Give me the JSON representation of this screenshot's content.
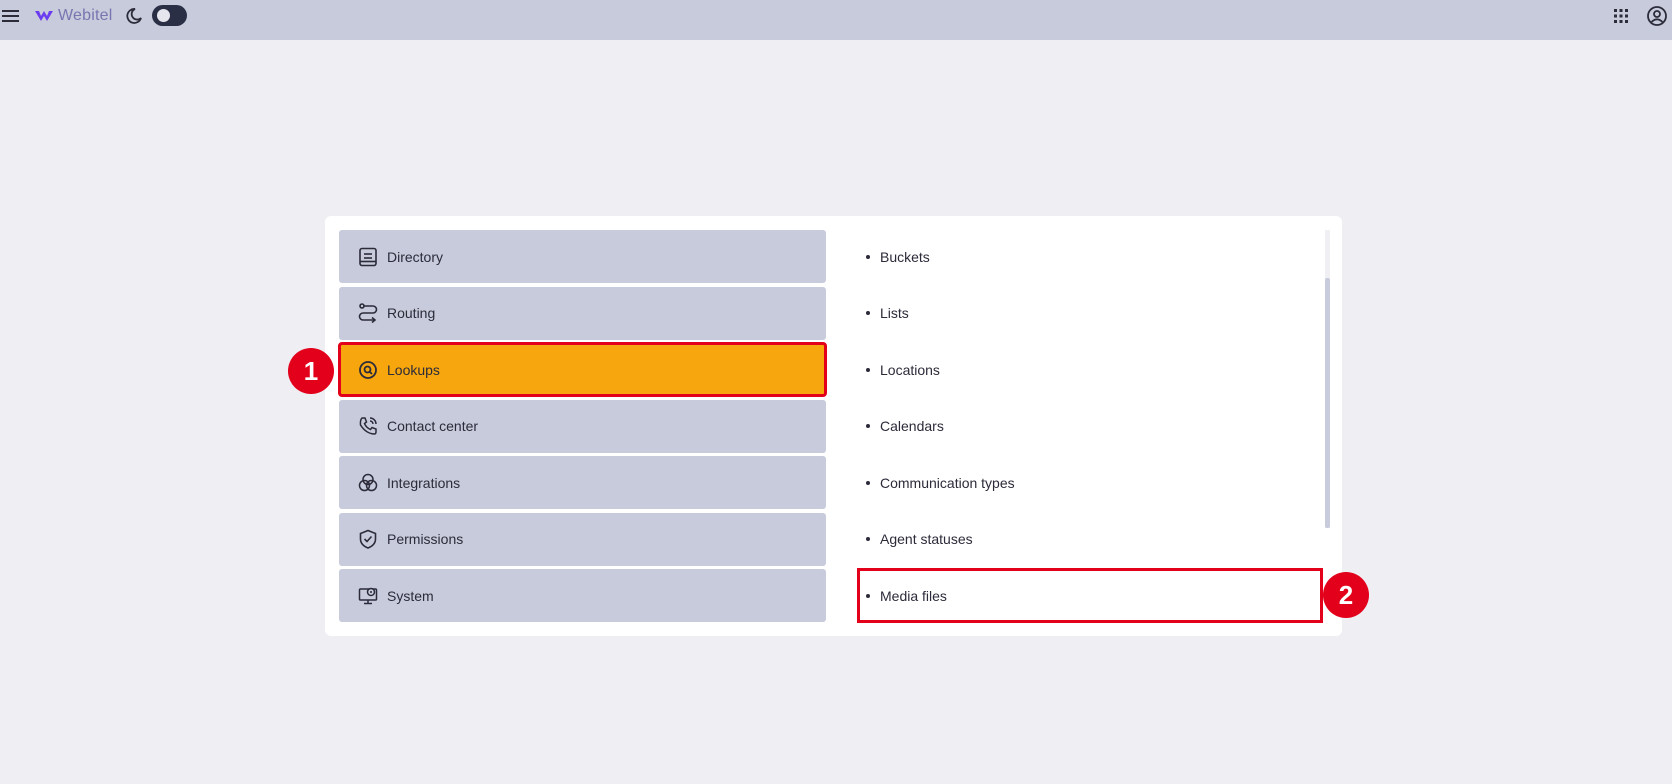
{
  "app": {
    "logo_text": "Webitel"
  },
  "nav": {
    "items": [
      {
        "label": "Directory",
        "icon": "directory-icon"
      },
      {
        "label": "Routing",
        "icon": "routing-icon"
      },
      {
        "label": "Lookups",
        "icon": "lookups-icon",
        "active": true
      },
      {
        "label": "Contact center",
        "icon": "phone-icon"
      },
      {
        "label": "Integrations",
        "icon": "integrations-icon"
      },
      {
        "label": "Permissions",
        "icon": "shield-icon"
      },
      {
        "label": "System",
        "icon": "monitor-icon"
      }
    ]
  },
  "sub": {
    "items": [
      {
        "label": "Buckets"
      },
      {
        "label": "Lists"
      },
      {
        "label": "Locations"
      },
      {
        "label": "Calendars"
      },
      {
        "label": "Communication types"
      },
      {
        "label": "Agent statuses"
      },
      {
        "label": "Media files",
        "highlight": true
      }
    ]
  },
  "annotations": {
    "badge_1": "1",
    "badge_2": "2"
  },
  "colors": {
    "topbar": "#c8cbdb",
    "active_item": "#f7a60d",
    "annotation_red": "#e3001b",
    "background": "#eeeef3"
  }
}
